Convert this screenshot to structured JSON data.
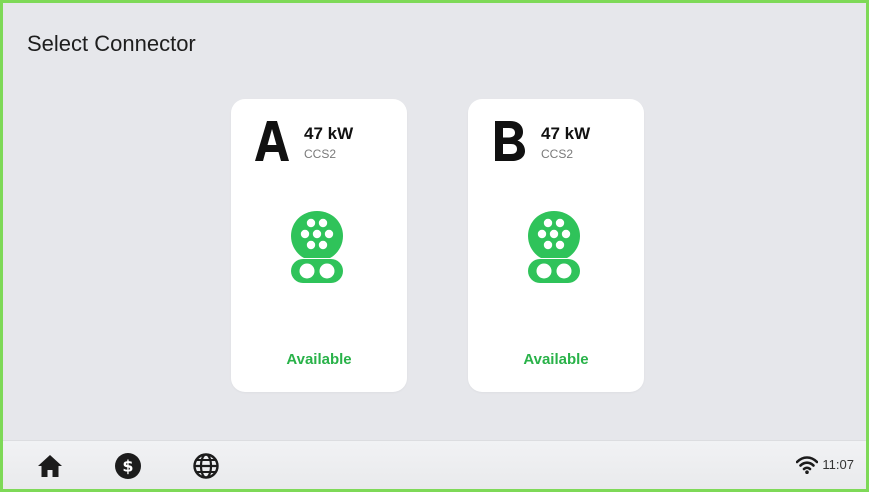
{
  "page": {
    "title": "Select Connector"
  },
  "connectors": [
    {
      "letter": "A",
      "power": "47 kW",
      "type": "CCS2",
      "status": "Available",
      "icon": "ccs2-plug-icon"
    },
    {
      "letter": "B",
      "power": "47 kW",
      "type": "CCS2",
      "status": "Available",
      "icon": "ccs2-plug-icon"
    }
  ],
  "bottom_bar": {
    "icons": [
      "home-icon",
      "dollar-icon",
      "globe-icon"
    ],
    "status_icon": "wifi-icon",
    "time": "11:07"
  },
  "colors": {
    "frame_border": "#7ed957",
    "background": "#e6e7eb",
    "accent_green": "#2fc35a",
    "status_green": "#29b249"
  }
}
